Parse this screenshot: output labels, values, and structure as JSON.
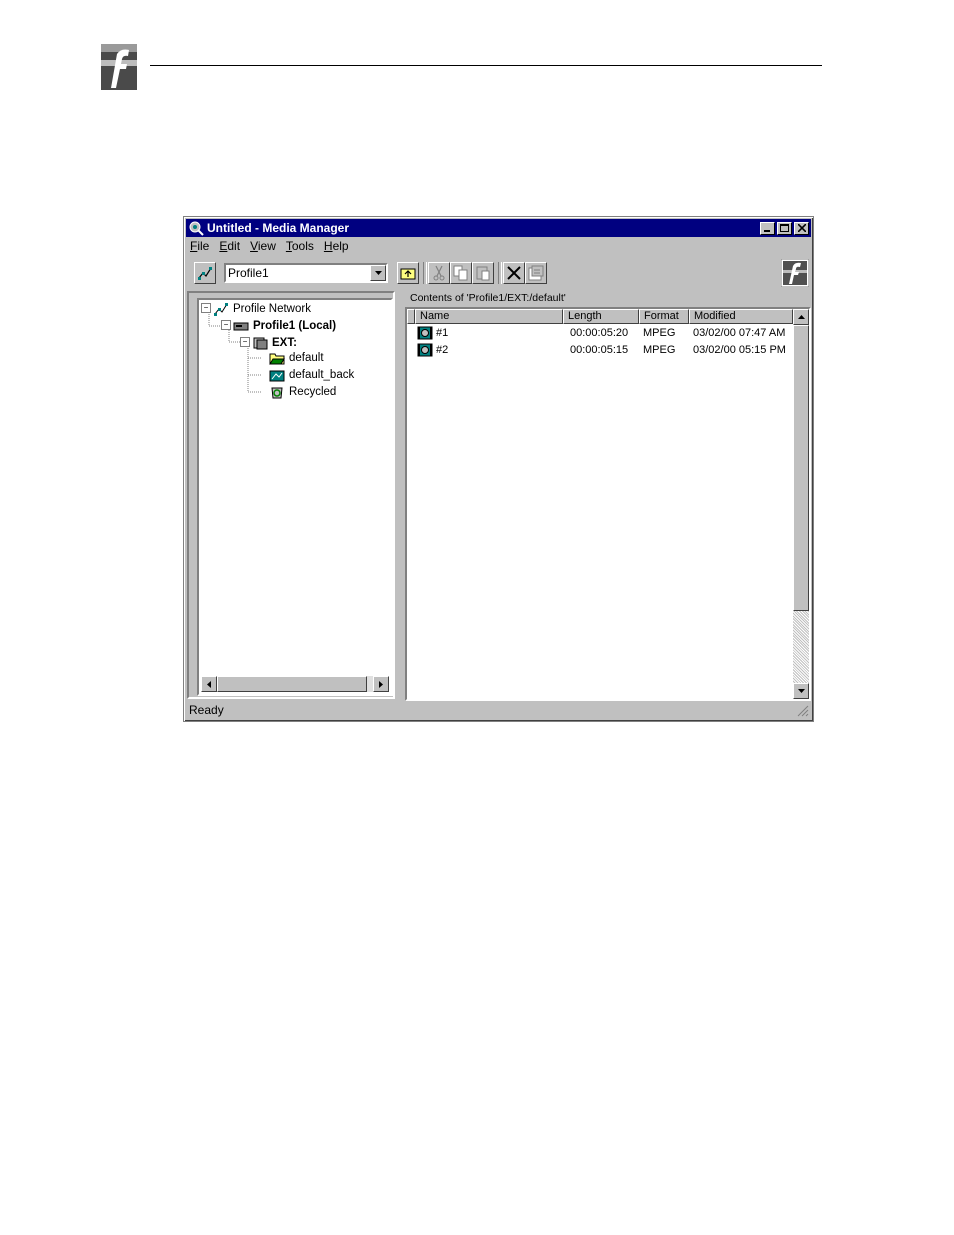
{
  "window": {
    "title": "Untitled - Media Manager",
    "controls": [
      "minimize",
      "maximize",
      "close"
    ]
  },
  "menu": [
    {
      "label": "File"
    },
    {
      "label": "Edit"
    },
    {
      "label": "View"
    },
    {
      "label": "Tools"
    },
    {
      "label": "Help"
    }
  ],
  "toolbar": {
    "machine_select": "Profile1",
    "buttons": [
      "network-icon",
      "up-folder-icon",
      "cut-icon",
      "copy-icon",
      "paste-icon",
      "delete-icon",
      "properties-icon"
    ]
  },
  "tree": {
    "root": "Profile Network",
    "machine": "Profile1 (Local)",
    "volume": "EXT:",
    "bins": [
      {
        "label": "default"
      },
      {
        "label": "default_back"
      },
      {
        "label": "Recycled"
      }
    ]
  },
  "contents": {
    "path_label": "Contents of 'Profile1/EXT:/default'",
    "columns": [
      "Name",
      "Length",
      "Format",
      "Modified"
    ],
    "rows": [
      {
        "name": "#1",
        "length": "00:00:05:20",
        "format": "MPEG",
        "modified": "03/02/00 07:47 AM"
      },
      {
        "name": "#2",
        "length": "00:00:05:15",
        "format": "MPEG",
        "modified": "03/02/00 05:15 PM"
      }
    ]
  },
  "status": "Ready"
}
